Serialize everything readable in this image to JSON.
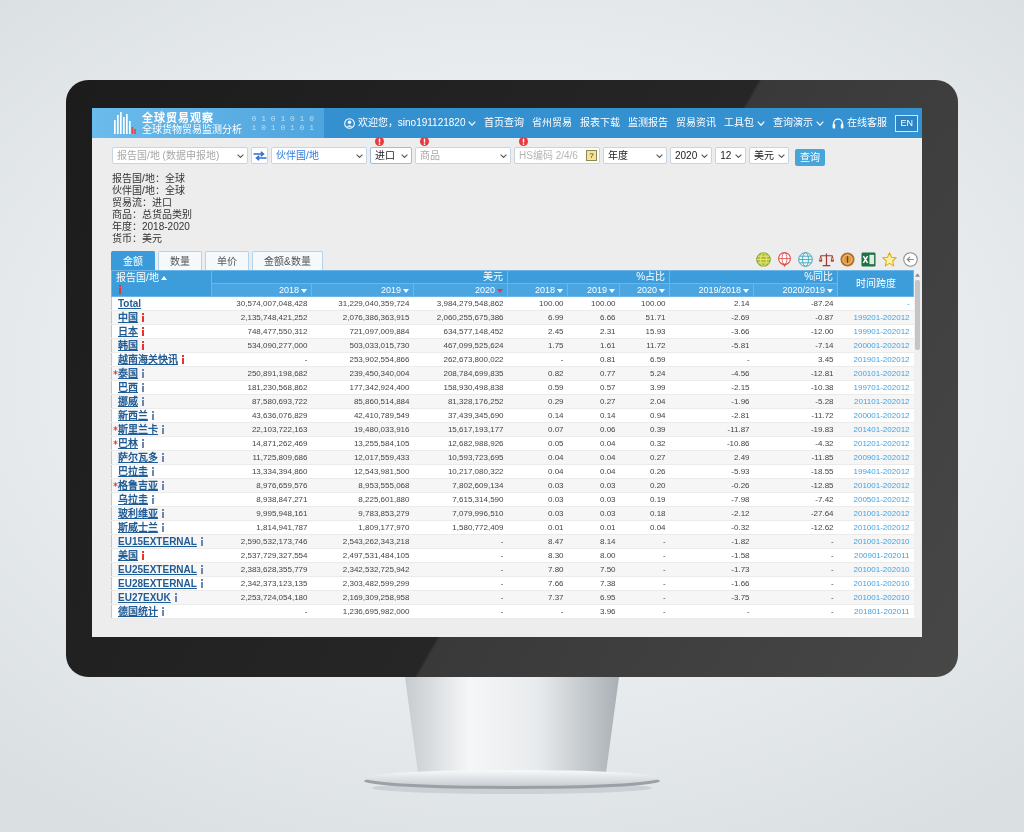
{
  "header": {
    "logo": {
      "title": "全球贸易观察",
      "subtitle": "全球货物贸易监测分析",
      "digits": [
        "0 1 0 1 0 1 0",
        "1 0 1 0 1 0 1"
      ]
    },
    "user": "欢迎您，sino191121820",
    "nav": [
      {
        "label": "首页查询",
        "dropdown": false
      },
      {
        "label": "省州贸易",
        "dropdown": false
      },
      {
        "label": "报表下载",
        "dropdown": false
      },
      {
        "label": "监测报告",
        "dropdown": false
      },
      {
        "label": "贸易资讯",
        "dropdown": false
      },
      {
        "label": "工具包",
        "dropdown": true
      },
      {
        "label": "查询演示",
        "dropdown": true
      }
    ],
    "support": "在线客服",
    "language": "EN"
  },
  "filters": [
    {
      "kind": "select",
      "placeholder": "报告国/地 (数据申报地)",
      "required": false,
      "accent": false
    },
    {
      "kind": "swap"
    },
    {
      "kind": "select",
      "value": "伙伴国/地",
      "required": false,
      "accent": true
    },
    {
      "kind": "select",
      "value": "进口",
      "required": true,
      "accent": false
    },
    {
      "kind": "select",
      "placeholder": "商品",
      "required": true,
      "accent": false
    },
    {
      "kind": "input",
      "placeholder": "HS编码 2/4/6",
      "help": "?",
      "required": true
    },
    {
      "kind": "select",
      "value": "年度",
      "required": false,
      "accent": false
    },
    {
      "kind": "select",
      "value": "2020",
      "required": false,
      "accent": false
    },
    {
      "kind": "select",
      "value": "12",
      "required": false,
      "accent": false
    },
    {
      "kind": "select",
      "value": "美元",
      "required": false,
      "accent": false
    },
    {
      "kind": "button",
      "label": "查询"
    }
  ],
  "summary": [
    "报告国/地：全球",
    "伙伴国/地：全球",
    "贸易流：进口",
    "商品：总货品类别",
    "年度：2018-2020",
    "货币：美元"
  ],
  "tabs": [
    {
      "label": "金额",
      "selected": true
    },
    {
      "label": "数量",
      "selected": false
    },
    {
      "label": "单价",
      "selected": false
    },
    {
      "label": "金额&数量",
      "selected": false
    }
  ],
  "table": {
    "name_column": {
      "label": "报告国/地",
      "sort_up": true,
      "info": {
        "color": "#e8322b"
      }
    },
    "groups": [
      {
        "label": "美元",
        "columns": [
          {
            "label": "2018",
            "sorted": false
          },
          {
            "label": "2019",
            "sorted": false
          },
          {
            "label": "2020",
            "sorted": true
          }
        ]
      },
      {
        "label": "%占比",
        "columns": [
          {
            "label": "2018",
            "sorted": false
          },
          {
            "label": "2019",
            "sorted": false
          },
          {
            "label": "2020",
            "sorted": false
          }
        ]
      },
      {
        "label": "%同比",
        "columns": [
          {
            "label": "2019/2018",
            "sorted": false
          },
          {
            "label": "2020/2019",
            "sorted": false
          }
        ]
      }
    ],
    "span_column": {
      "label": "时间跨度"
    },
    "rows": [
      {
        "name": "Total",
        "flagged": false,
        "values": [
          "30,574,007,048,428",
          "31,229,040,359,724",
          "3,984,279,548,862",
          "100.00",
          "100.00",
          "100.00",
          "2.14",
          "-87.24"
        ],
        "span": "-"
      },
      {
        "name": "中国",
        "flagged": false,
        "info": {
          "color": "#e8322b"
        },
        "values": [
          "2,135,748,421,252",
          "2,076,386,363,915",
          "2,060,255,675,386",
          "6.99",
          "6.66",
          "51.71",
          "-2.69",
          "-0.87"
        ],
        "span": "199201-202012"
      },
      {
        "name": "日本",
        "flagged": false,
        "info": {
          "color": "#e8322b"
        },
        "values": [
          "748,477,550,312",
          "721,097,009,884",
          "634,577,148,452",
          "2.45",
          "2.31",
          "15.93",
          "-3.66",
          "-12.00"
        ],
        "span": "199901-202012"
      },
      {
        "name": "韩国",
        "flagged": false,
        "info": {
          "color": "#e8322b"
        },
        "values": [
          "534,090,277,000",
          "503,033,015,730",
          "467,099,525,624",
          "1.75",
          "1.61",
          "11.72",
          "-5.81",
          "-7.14"
        ],
        "span": "200001-202012"
      },
      {
        "name": "越南海关快讯",
        "flagged": false,
        "info": {
          "color": "#e8322b"
        },
        "values": [
          "-",
          "253,902,554,866",
          "262,673,800,022",
          "-",
          "0.81",
          "6.59",
          "-",
          "3.45"
        ],
        "span": "201901-202012"
      },
      {
        "name": "泰国",
        "flagged": true,
        "info": {
          "color": "#6c86ad"
        },
        "values": [
          "250,891,198,682",
          "239,450,340,004",
          "208,784,699,835",
          "0.82",
          "0.77",
          "5.24",
          "-4.56",
          "-12.81"
        ],
        "span": "200101-202012"
      },
      {
        "name": "巴西",
        "flagged": false,
        "info": {
          "color": "#6c86ad"
        },
        "values": [
          "181,230,568,862",
          "177,342,924,400",
          "158,930,498,838",
          "0.59",
          "0.57",
          "3.99",
          "-2.15",
          "-10.38"
        ],
        "span": "199701-202012"
      },
      {
        "name": "挪威",
        "flagged": false,
        "info": {
          "color": "#6c86ad"
        },
        "values": [
          "87,580,693,722",
          "85,860,514,884",
          "81,328,176,252",
          "0.29",
          "0.27",
          "2.04",
          "-1.96",
          "-5.28"
        ],
        "span": "201101-202012"
      },
      {
        "name": "新西兰",
        "flagged": false,
        "info": {
          "color": "#6c86ad"
        },
        "values": [
          "43,636,076,829",
          "42,410,789,549",
          "37,439,345,690",
          "0.14",
          "0.14",
          "0.94",
          "-2.81",
          "-11.72"
        ],
        "span": "200001-202012"
      },
      {
        "name": "斯里兰卡",
        "flagged": true,
        "info": {
          "color": "#6c86ad"
        },
        "values": [
          "22,103,722,163",
          "19,480,033,916",
          "15,617,193,177",
          "0.07",
          "0.06",
          "0.39",
          "-11.87",
          "-19.83"
        ],
        "span": "201401-202012"
      },
      {
        "name": "巴林",
        "flagged": true,
        "info": {
          "color": "#6c86ad"
        },
        "values": [
          "14,871,262,469",
          "13,255,584,105",
          "12,682,988,926",
          "0.05",
          "0.04",
          "0.32",
          "-10.86",
          "-4.32"
        ],
        "span": "201201-202012"
      },
      {
        "name": "萨尔瓦多",
        "flagged": false,
        "info": {
          "color": "#6c86ad"
        },
        "values": [
          "11,725,809,686",
          "12,017,559,433",
          "10,593,723,695",
          "0.04",
          "0.04",
          "0.27",
          "2.49",
          "-11.85"
        ],
        "span": "200901-202012"
      },
      {
        "name": "巴拉圭",
        "flagged": false,
        "info": {
          "color": "#6c86ad"
        },
        "values": [
          "13,334,394,860",
          "12,543,981,500",
          "10,217,080,322",
          "0.04",
          "0.04",
          "0.26",
          "-5.93",
          "-18.55"
        ],
        "span": "199401-202012"
      },
      {
        "name": "格鲁吉亚",
        "flagged": true,
        "info": {
          "color": "#6c86ad"
        },
        "values": [
          "8,976,659,576",
          "8,953,555,068",
          "7,802,609,134",
          "0.03",
          "0.03",
          "0.20",
          "-0.26",
          "-12.85"
        ],
        "span": "201001-202012"
      },
      {
        "name": "乌拉圭",
        "flagged": false,
        "info": {
          "color": "#6c86ad"
        },
        "values": [
          "8,938,847,271",
          "8,225,601,880",
          "7,615,314,590",
          "0.03",
          "0.03",
          "0.19",
          "-7.98",
          "-7.42"
        ],
        "span": "200501-202012"
      },
      {
        "name": "玻利维亚",
        "flagged": false,
        "info": {
          "color": "#6c86ad"
        },
        "values": [
          "9,995,948,161",
          "9,783,853,279",
          "7,079,996,510",
          "0.03",
          "0.03",
          "0.18",
          "-2.12",
          "-27.64"
        ],
        "span": "201001-202012"
      },
      {
        "name": "斯威士兰",
        "flagged": false,
        "info": {
          "color": "#6c86ad"
        },
        "values": [
          "1,814,941,787",
          "1,809,177,970",
          "1,580,772,409",
          "0.01",
          "0.01",
          "0.04",
          "-0.32",
          "-12.62"
        ],
        "span": "201001-202012"
      },
      {
        "name": "EU15EXTERNAL",
        "flagged": false,
        "info": {
          "color": "#6c86ad"
        },
        "values": [
          "2,590,532,173,746",
          "2,543,262,343,218",
          "-",
          "8.47",
          "8.14",
          "-",
          "-1.82",
          "-"
        ],
        "span": "201001-202010"
      },
      {
        "name": "美国",
        "flagged": false,
        "info": {
          "color": "#e8322b"
        },
        "values": [
          "2,537,729,327,554",
          "2,497,531,484,105",
          "-",
          "8.30",
          "8.00",
          "-",
          "-1.58",
          "-"
        ],
        "span": "200901-202011"
      },
      {
        "name": "EU25EXTERNAL",
        "flagged": false,
        "info": {
          "color": "#6c86ad"
        },
        "values": [
          "2,383,628,355,779",
          "2,342,532,725,942",
          "-",
          "7.80",
          "7.50",
          "-",
          "-1.73",
          "-"
        ],
        "span": "201001-202010"
      },
      {
        "name": "EU28EXTERNAL",
        "flagged": false,
        "info": {
          "color": "#6c86ad"
        },
        "values": [
          "2,342,373,123,135",
          "2,303,482,599,299",
          "-",
          "7.66",
          "7.38",
          "-",
          "-1.66",
          "-"
        ],
        "span": "201001-202010"
      },
      {
        "name": "EU27EXUK",
        "flagged": false,
        "info": {
          "color": "#6c86ad"
        },
        "values": [
          "2,253,724,054,180",
          "2,169,309,258,958",
          "-",
          "7.37",
          "6.95",
          "-",
          "-3.75",
          "-"
        ],
        "span": "201001-202010"
      },
      {
        "name": "德国统计",
        "flagged": false,
        "info": {
          "color": "#6c86ad"
        },
        "values": [
          "-",
          "1,236,695,982,000",
          "-",
          "-",
          "3.96",
          "-",
          "-",
          "-"
        ],
        "span": "201801-202011"
      }
    ]
  }
}
